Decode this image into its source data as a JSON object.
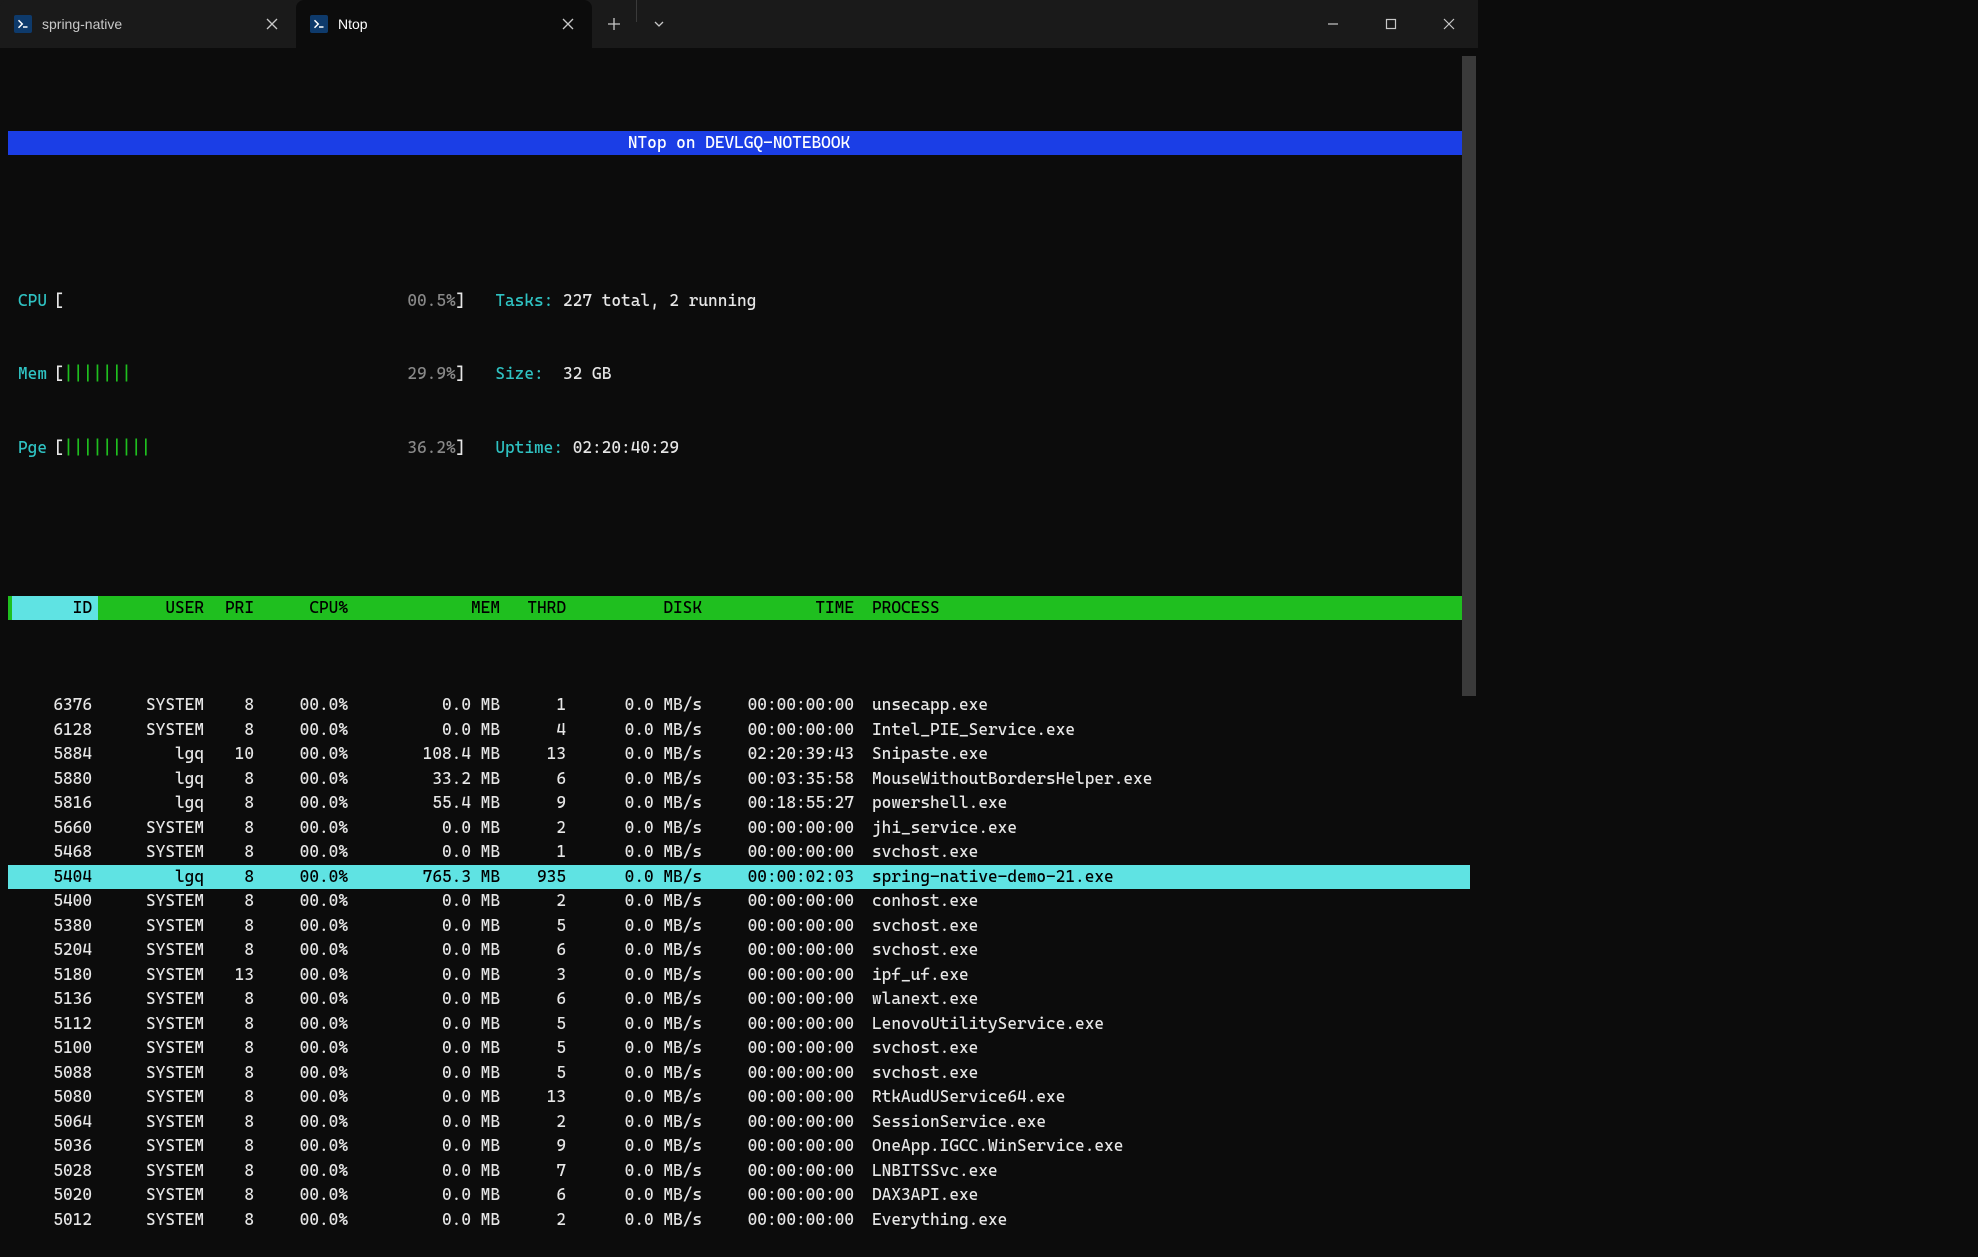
{
  "window": {
    "tabs": [
      {
        "title": "spring-native",
        "active": false
      },
      {
        "title": "Ntop",
        "active": true
      }
    ]
  },
  "banner": "NTop on DEVLGQ-NOTEBOOK",
  "meters": {
    "cpu": {
      "label": "CPU",
      "bars": "",
      "pct": "00.5%"
    },
    "mem": {
      "label": "Mem",
      "bars": "|||||||",
      "pct": "29.9%"
    },
    "pge": {
      "label": "Pge",
      "bars": "|||||||||",
      "pct": "36.2%"
    }
  },
  "stats": {
    "tasks_label": "Tasks:",
    "tasks_value": "227 total, 2 running",
    "size_label": "Size:",
    "size_value": "32 GB",
    "uptime_label": "Uptime:",
    "uptime_value": "02:20:40:29"
  },
  "columns": {
    "id": "ID",
    "user": "USER",
    "pri": "PRI",
    "cpu": "CPU%",
    "mem": "MEM",
    "thrd": "THRD",
    "disk": "DISK",
    "time": "TIME",
    "proc": "PROCESS"
  },
  "processes": [
    {
      "id": "6376",
      "user": "SYSTEM",
      "pri": "8",
      "cpu": "00.0%",
      "mem": "0.0 MB",
      "thrd": "1",
      "disk": "0.0 MB/s",
      "time": "00:00:00:00",
      "proc": "unsecapp.exe",
      "sel": false
    },
    {
      "id": "6128",
      "user": "SYSTEM",
      "pri": "8",
      "cpu": "00.0%",
      "mem": "0.0 MB",
      "thrd": "4",
      "disk": "0.0 MB/s",
      "time": "00:00:00:00",
      "proc": "Intel_PIE_Service.exe",
      "sel": false
    },
    {
      "id": "5884",
      "user": "lgq",
      "pri": "10",
      "cpu": "00.0%",
      "mem": "108.4 MB",
      "thrd": "13",
      "disk": "0.0 MB/s",
      "time": "02:20:39:43",
      "proc": "Snipaste.exe",
      "sel": false
    },
    {
      "id": "5880",
      "user": "lgq",
      "pri": "8",
      "cpu": "00.0%",
      "mem": "33.2 MB",
      "thrd": "6",
      "disk": "0.0 MB/s",
      "time": "00:03:35:58",
      "proc": "MouseWithoutBordersHelper.exe",
      "sel": false
    },
    {
      "id": "5816",
      "user": "lgq",
      "pri": "8",
      "cpu": "00.0%",
      "mem": "55.4 MB",
      "thrd": "9",
      "disk": "0.0 MB/s",
      "time": "00:18:55:27",
      "proc": "powershell.exe",
      "sel": false
    },
    {
      "id": "5660",
      "user": "SYSTEM",
      "pri": "8",
      "cpu": "00.0%",
      "mem": "0.0 MB",
      "thrd": "2",
      "disk": "0.0 MB/s",
      "time": "00:00:00:00",
      "proc": "jhi_service.exe",
      "sel": false
    },
    {
      "id": "5468",
      "user": "SYSTEM",
      "pri": "8",
      "cpu": "00.0%",
      "mem": "0.0 MB",
      "thrd": "1",
      "disk": "0.0 MB/s",
      "time": "00:00:00:00",
      "proc": "svchost.exe",
      "sel": false
    },
    {
      "id": "5404",
      "user": "lgq",
      "pri": "8",
      "cpu": "00.0%",
      "mem": "765.3 MB",
      "thrd": "935",
      "disk": "0.0 MB/s",
      "time": "00:00:02:03",
      "proc": "spring-native-demo-21.exe",
      "sel": true
    },
    {
      "id": "5400",
      "user": "SYSTEM",
      "pri": "8",
      "cpu": "00.0%",
      "mem": "0.0 MB",
      "thrd": "2",
      "disk": "0.0 MB/s",
      "time": "00:00:00:00",
      "proc": "conhost.exe",
      "sel": false
    },
    {
      "id": "5380",
      "user": "SYSTEM",
      "pri": "8",
      "cpu": "00.0%",
      "mem": "0.0 MB",
      "thrd": "5",
      "disk": "0.0 MB/s",
      "time": "00:00:00:00",
      "proc": "svchost.exe",
      "sel": false
    },
    {
      "id": "5204",
      "user": "SYSTEM",
      "pri": "8",
      "cpu": "00.0%",
      "mem": "0.0 MB",
      "thrd": "6",
      "disk": "0.0 MB/s",
      "time": "00:00:00:00",
      "proc": "svchost.exe",
      "sel": false
    },
    {
      "id": "5180",
      "user": "SYSTEM",
      "pri": "13",
      "cpu": "00.0%",
      "mem": "0.0 MB",
      "thrd": "3",
      "disk": "0.0 MB/s",
      "time": "00:00:00:00",
      "proc": "ipf_uf.exe",
      "sel": false
    },
    {
      "id": "5136",
      "user": "SYSTEM",
      "pri": "8",
      "cpu": "00.0%",
      "mem": "0.0 MB",
      "thrd": "6",
      "disk": "0.0 MB/s",
      "time": "00:00:00:00",
      "proc": "wlanext.exe",
      "sel": false
    },
    {
      "id": "5112",
      "user": "SYSTEM",
      "pri": "8",
      "cpu": "00.0%",
      "mem": "0.0 MB",
      "thrd": "5",
      "disk": "0.0 MB/s",
      "time": "00:00:00:00",
      "proc": "LenovoUtilityService.exe",
      "sel": false
    },
    {
      "id": "5100",
      "user": "SYSTEM",
      "pri": "8",
      "cpu": "00.0%",
      "mem": "0.0 MB",
      "thrd": "5",
      "disk": "0.0 MB/s",
      "time": "00:00:00:00",
      "proc": "svchost.exe",
      "sel": false
    },
    {
      "id": "5088",
      "user": "SYSTEM",
      "pri": "8",
      "cpu": "00.0%",
      "mem": "0.0 MB",
      "thrd": "5",
      "disk": "0.0 MB/s",
      "time": "00:00:00:00",
      "proc": "svchost.exe",
      "sel": false
    },
    {
      "id": "5080",
      "user": "SYSTEM",
      "pri": "8",
      "cpu": "00.0%",
      "mem": "0.0 MB",
      "thrd": "13",
      "disk": "0.0 MB/s",
      "time": "00:00:00:00",
      "proc": "RtkAudUService64.exe",
      "sel": false
    },
    {
      "id": "5064",
      "user": "SYSTEM",
      "pri": "8",
      "cpu": "00.0%",
      "mem": "0.0 MB",
      "thrd": "2",
      "disk": "0.0 MB/s",
      "time": "00:00:00:00",
      "proc": "SessionService.exe",
      "sel": false
    },
    {
      "id": "5036",
      "user": "SYSTEM",
      "pri": "8",
      "cpu": "00.0%",
      "mem": "0.0 MB",
      "thrd": "9",
      "disk": "0.0 MB/s",
      "time": "00:00:00:00",
      "proc": "OneApp.IGCC.WinService.exe",
      "sel": false
    },
    {
      "id": "5028",
      "user": "SYSTEM",
      "pri": "8",
      "cpu": "00.0%",
      "mem": "0.0 MB",
      "thrd": "7",
      "disk": "0.0 MB/s",
      "time": "00:00:00:00",
      "proc": "LNBITSSvc.exe",
      "sel": false
    },
    {
      "id": "5020",
      "user": "SYSTEM",
      "pri": "8",
      "cpu": "00.0%",
      "mem": "0.0 MB",
      "thrd": "6",
      "disk": "0.0 MB/s",
      "time": "00:00:00:00",
      "proc": "DAX3API.exe",
      "sel": false
    },
    {
      "id": "5012",
      "user": "SYSTEM",
      "pri": "8",
      "cpu": "00.0%",
      "mem": "0.0 MB",
      "thrd": "2",
      "disk": "0.0 MB/s",
      "time": "00:00:00:00",
      "proc": "Everything.exe",
      "sel": false
    }
  ]
}
